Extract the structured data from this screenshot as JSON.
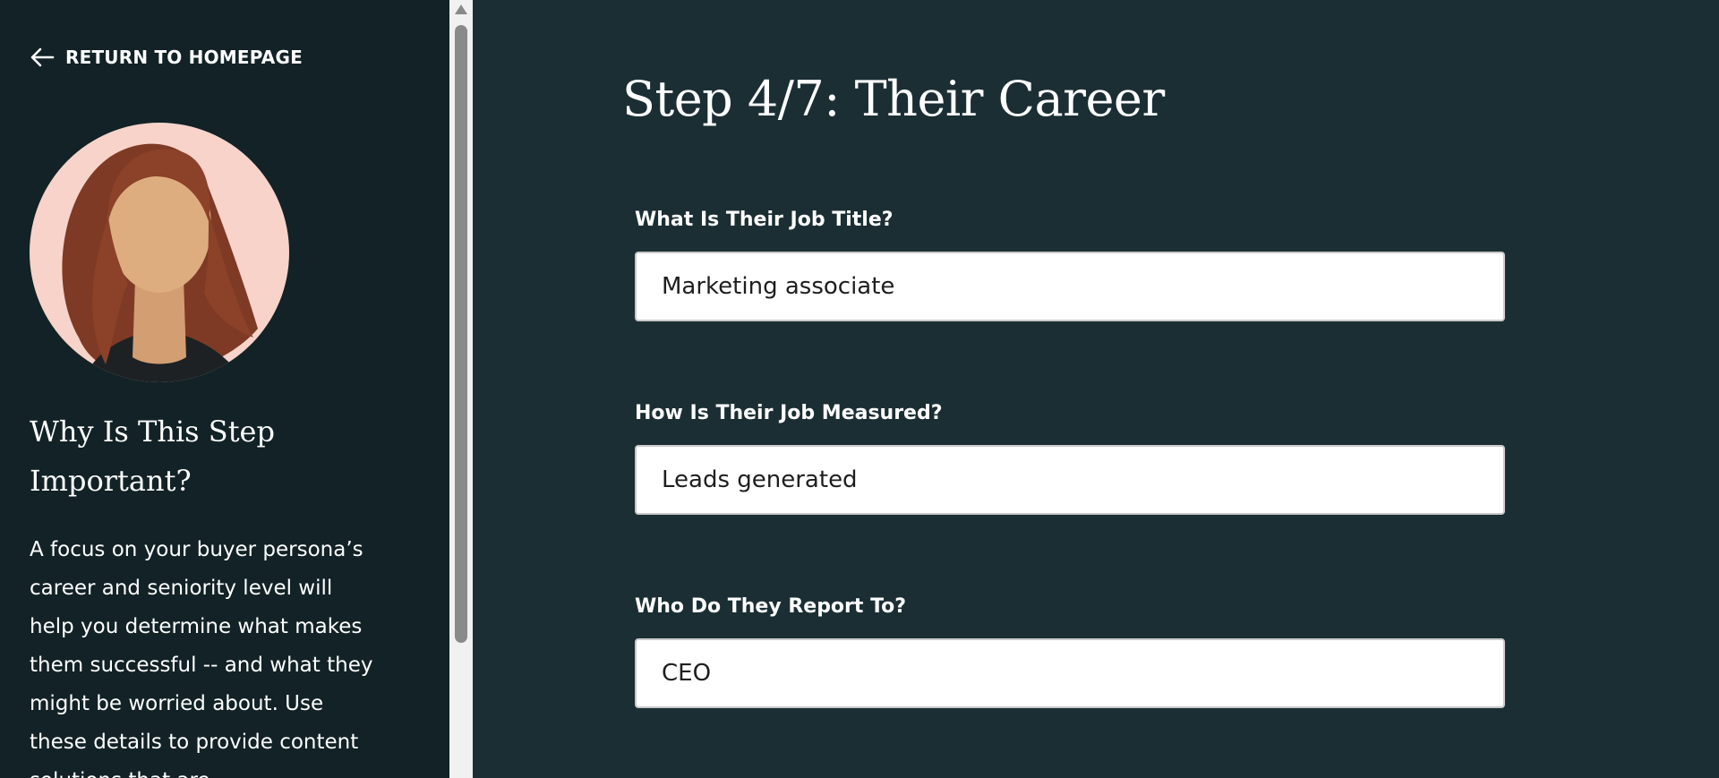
{
  "sidebar": {
    "return_link": "RETURN TO HOMEPAGE",
    "heading": "Why Is This Step Important?",
    "description": "A focus on your buyer persona’s career and seniority level will help you determine what makes them successful -- and what they might be worried about. Use these details to provide content solutions that are"
  },
  "main": {
    "title": "Step 4/7: Their Career",
    "fields": [
      {
        "label": "What Is Their Job Title?",
        "value": "Marketing associate"
      },
      {
        "label": "How Is Their Job Measured?",
        "value": "Leads generated"
      },
      {
        "label": "Who Do They Report To?",
        "value": "CEO"
      }
    ]
  },
  "colors": {
    "sidebar_bg": "#122226",
    "main_bg": "#1b2e33",
    "avatar_bg": "#f7d3ca",
    "text": "#ffffff"
  },
  "icons": [
    "arrow-left-icon",
    "persona-avatar"
  ]
}
